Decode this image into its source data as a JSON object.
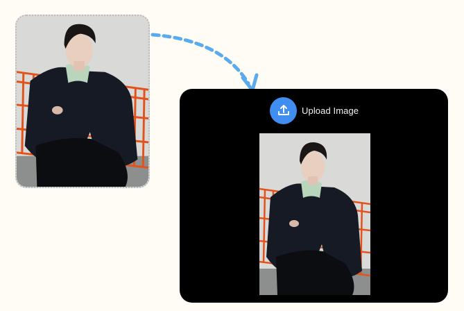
{
  "upload": {
    "label": "Upload Image",
    "icon": "upload-icon"
  },
  "colors": {
    "background": "#fefcf4",
    "panel": "#000000",
    "accent_blue": "#3f8ef0",
    "arrow": "#5aabee",
    "bench_orange": "#e2521d"
  }
}
